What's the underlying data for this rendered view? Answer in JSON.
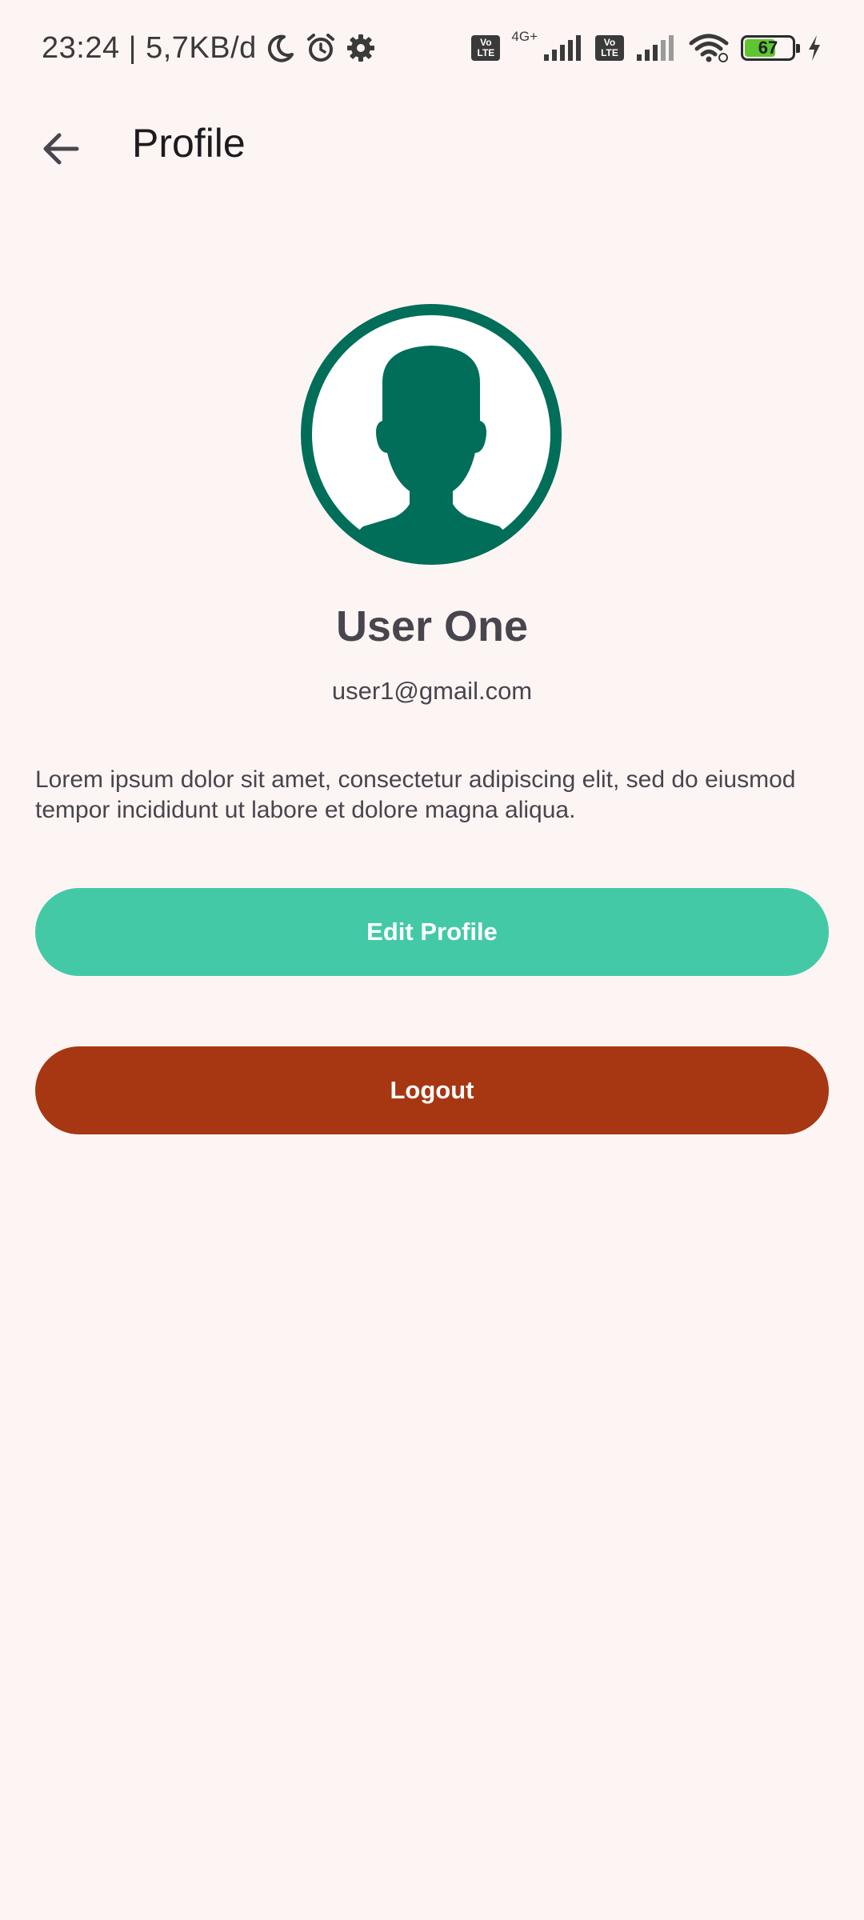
{
  "status_bar": {
    "time_and_speed": "23:24 | 5,7KB/d",
    "net_type": "4G+",
    "volte_label": "Vo LTE",
    "battery_level": "67"
  },
  "app_bar": {
    "title": "Profile"
  },
  "profile": {
    "name": "User One",
    "email": "user1@gmail.com",
    "bio": "Lorem ipsum dolor sit amet, consectetur adipiscing elit, sed do eiusmod tempor incididunt ut labore et dolore magna aliqua.",
    "avatar_icon": "person-silhouette-icon"
  },
  "actions": {
    "edit_label": "Edit Profile",
    "logout_label": "Logout"
  },
  "colors": {
    "background": "#fdf5f3",
    "avatar": "#006e58",
    "edit_button": "#44c9a7",
    "logout_button": "#a73712"
  }
}
